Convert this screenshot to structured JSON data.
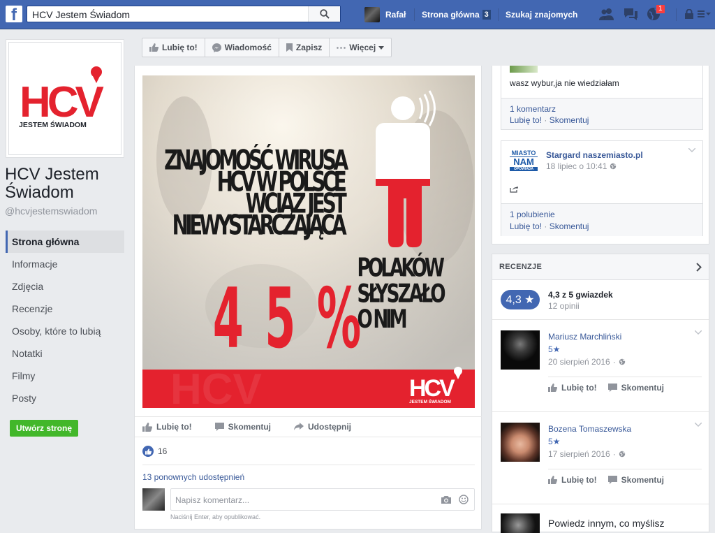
{
  "topbar": {
    "logo": "f",
    "search_value": "HCV Jestem Świadom",
    "user_name": "Rafał",
    "home_label": "Strona główna",
    "home_count": "3",
    "find_friends": "Szukaj znajomych",
    "notification_count": "1",
    "brand_color": "#4267b2"
  },
  "sidebar": {
    "logo_text": "HCV",
    "logo_tagline": "JESTEM ŚWIADOM",
    "page_name": "HCV Jestem Świadom",
    "page_handle": "@hcvjestemswiadom",
    "nav": [
      {
        "label": "Strona główna",
        "active": true
      },
      {
        "label": "Informacje"
      },
      {
        "label": "Zdjęcia"
      },
      {
        "label": "Recenzje"
      },
      {
        "label": "Osoby, które to lubią"
      },
      {
        "label": "Notatki"
      },
      {
        "label": "Filmy"
      },
      {
        "label": "Posty"
      }
    ],
    "create_page": "Utwórz stronę"
  },
  "page_actions": {
    "like": "Lubię to!",
    "message": "Wiadomość",
    "save": "Zapisz",
    "more": "Więcej"
  },
  "post": {
    "image": {
      "line1": "ZNAJOMOŚĆ WIRUSA",
      "line2": "HCV W POLSCE",
      "line3": "WCIĄŻ JEST",
      "line4": "NIEWYSTARCZAJĄCA",
      "percent": "45%",
      "side1": "POLAKÓW",
      "side2": "SŁYSZAŁO",
      "side3": "O NIM",
      "footer_logo": "HCV",
      "footer_tagline": "JESTEM ŚWIADOM",
      "red": "#e4222e"
    },
    "actions": {
      "like": "Lubię to!",
      "comment": "Skomentuj",
      "share": "Udostępnij"
    },
    "likes_count": "16",
    "shares_text": "13 ponownych udostępnień",
    "comment_placeholder": "Napisz komentarz...",
    "comment_hint": "Naciśnij Enter, aby opublikować."
  },
  "right": {
    "card1": {
      "text": "wasz wybur,ja nie wiedziałam",
      "comments": "1 komentarz",
      "like": "Lubię to!",
      "comment": "Skomentuj"
    },
    "card2": {
      "avatar_line1": "MIASTO",
      "avatar_line2": "NAM",
      "avatar_line3": "OPOWIADA",
      "name": "Stargard naszemiasto.pl",
      "date": "18 lipiec o 10:41",
      "likes": "1 polubienie",
      "like": "Lubię to!",
      "comment": "Skomentuj"
    },
    "reviews": {
      "header": "RECENZJE",
      "rating": "4,3 ★",
      "rating_text": "4,3 z 5 gwiazdek",
      "count": "12 opinii",
      "items": [
        {
          "name": "Mariusz Marchliński",
          "stars": "5★",
          "date": "20 sierpień 2016",
          "like": "Lubię to!",
          "comment": "Skomentuj"
        },
        {
          "name": "Bozena Tomaszewska",
          "stars": "5★",
          "date": "17 sierpień 2016",
          "like": "Lubię to!",
          "comment": "Skomentuj"
        }
      ],
      "prompt": "Powiedz innym, co myślisz"
    }
  }
}
